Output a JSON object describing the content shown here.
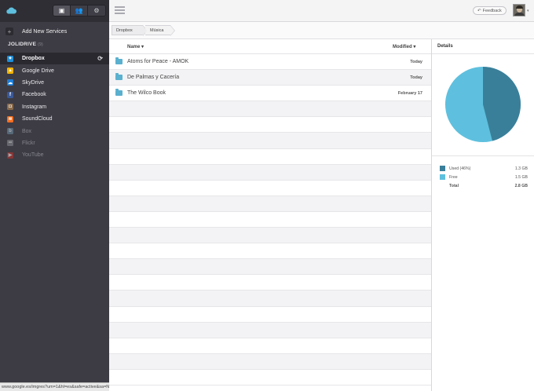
{
  "sidebar": {
    "tabs": [
      {
        "name": "files",
        "icon": "briefcase-icon",
        "glyph": "▣",
        "active": true
      },
      {
        "name": "users",
        "icon": "users-icon",
        "glyph": "👥",
        "active": false
      },
      {
        "name": "settings",
        "icon": "gear-icon",
        "glyph": "⚙",
        "active": false
      }
    ],
    "add_services_label": "Add New Services",
    "add_glyph": "+",
    "section_title": "JOLIDRIVE",
    "section_count": "(9)",
    "services": [
      {
        "label": "Dropbox",
        "color": "#1f8fd8",
        "glyph": "✦",
        "active": true
      },
      {
        "label": "Google Drive",
        "color": "#f2b400",
        "glyph": "▲",
        "active": false
      },
      {
        "label": "SkyDrive",
        "color": "#1e7ed6",
        "glyph": "☁",
        "active": false
      },
      {
        "label": "Facebook",
        "color": "#3b5998",
        "glyph": "f",
        "active": false
      },
      {
        "label": "Instagram",
        "color": "#8a6b4c",
        "glyph": "◘",
        "active": false
      },
      {
        "label": "SoundCloud",
        "color": "#f26f23",
        "glyph": "≋",
        "active": false
      },
      {
        "label": "Box",
        "color": "#6b8ea5",
        "glyph": "b",
        "active": false,
        "disabled": true
      },
      {
        "label": "Flickr",
        "color": "#8b8b93",
        "glyph": "••",
        "active": false,
        "disabled": true
      },
      {
        "label": "YouTube",
        "color": "#c4302b",
        "glyph": "▶",
        "active": false,
        "disabled": true
      }
    ],
    "sync_glyph": "⟳"
  },
  "topbar": {
    "feedback_label": "Feedback",
    "feedback_glyph": "↶",
    "avatar_caret": "▾"
  },
  "breadcrumb": [
    "Dropbox",
    "Música"
  ],
  "files": {
    "col_name": "Name",
    "col_modified": "Modified",
    "sort_glyph": "▾",
    "rows": [
      {
        "name": "Atoms for Peace - AMOK",
        "modified": "Today"
      },
      {
        "name": "De Palmas y Cacería",
        "modified": "Today"
      },
      {
        "name": "The Wilco Book",
        "modified": "February 17"
      }
    ],
    "total_rows": 21
  },
  "details": {
    "title": "Details",
    "used_fraction": 0.46,
    "colors": {
      "used": "#3a7f99",
      "free": "#5ec0de"
    },
    "legend": [
      {
        "label": "Used (46%)",
        "value": "1.3 GB",
        "color": "#3a7f99"
      },
      {
        "label": "Free",
        "value": "1.5 GB",
        "color": "#5ec0de"
      }
    ],
    "total_label": "Total",
    "total_value": "2.8 GB"
  },
  "status_url": "www.google.es/imgres?um=1&hl=es&safe=active&sa=N&biw=1280&bih=9..."
}
